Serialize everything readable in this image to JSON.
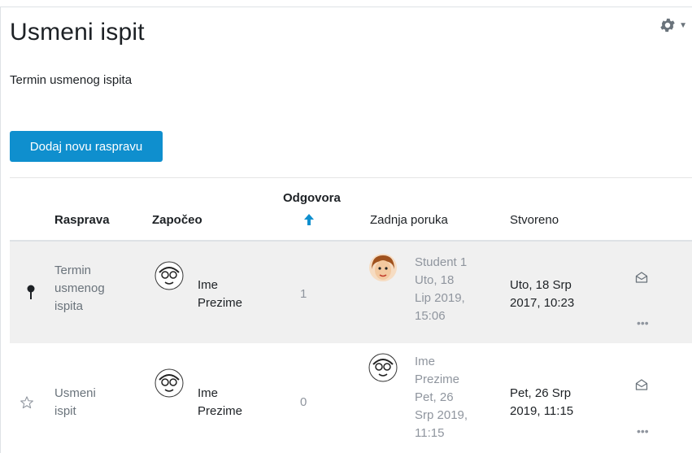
{
  "page": {
    "title": "Usmeni ispit",
    "intro": "Termin usmenog ispita",
    "add_button": "Dodaj novu raspravu",
    "icons": {
      "settings": "gear-icon",
      "settings_menu": "chevron-down-icon"
    }
  },
  "table": {
    "headers": {
      "discussion": "Rasprava",
      "started_by": "Započeo",
      "replies": "Odgovora",
      "last_post": "Zadnja poruka",
      "created": "Stvoreno"
    },
    "sort": {
      "column": "replies",
      "direction": "ascending",
      "icon": "arrow-up-icon"
    },
    "rows": [
      {
        "status_icon": "pin-icon",
        "discussion": "Termin usmenog ispita",
        "discussion_lines": [
          "Termin",
          "usmenog",
          "ispita"
        ],
        "author": "Ime Prezime",
        "author_lines": [
          "Ime",
          "Prezime"
        ],
        "replies": "1",
        "last_post_author": "Student 1",
        "last_post_lines": [
          "Student 1",
          "Uto, 18",
          "Lip 2019,",
          "15:06"
        ],
        "created_lines": [
          "Uto, 18 Srp",
          "2017, 10:23"
        ],
        "subscribe_icon": "envelope-open-icon",
        "menu_icon": "more-dots-icon",
        "menu_label": "•••"
      },
      {
        "status_icon": "star-outline-icon",
        "discussion": "Usmeni ispit",
        "discussion_lines": [
          "Usmeni",
          "ispit"
        ],
        "author": "Ime Prezime",
        "author_lines": [
          "Ime",
          "Prezime"
        ],
        "replies": "0",
        "last_post_lines": [
          "Ime",
          "Prezime",
          "Pet, 26",
          "Srp 2019,",
          "11:15"
        ],
        "created_lines": [
          "Pet, 26 Srp",
          "2019, 11:15"
        ],
        "subscribe_icon": "envelope-open-icon",
        "menu_icon": "more-dots-icon",
        "menu_label": "•••"
      }
    ]
  },
  "colors": {
    "primary_button": "#0f8fce",
    "sort_arrow": "#0f8fce",
    "row_highlight": "#f0f0f0"
  }
}
